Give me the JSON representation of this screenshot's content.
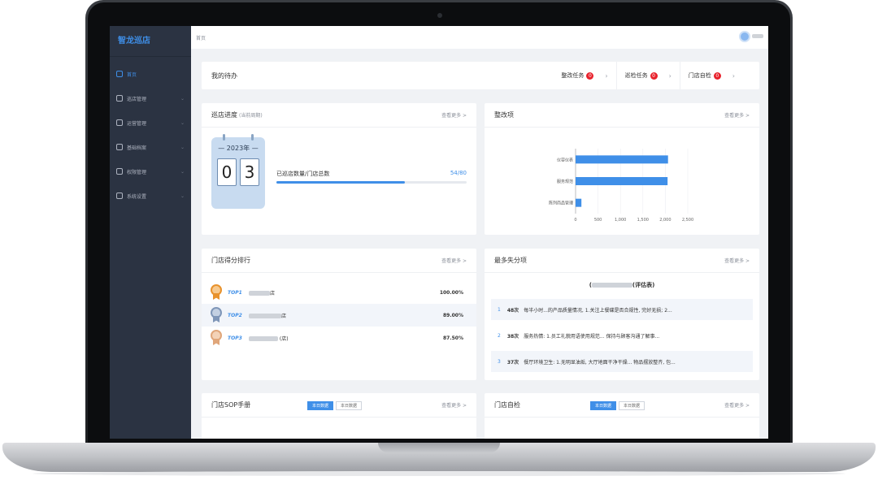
{
  "app": {
    "brand": "智龙巡店",
    "breadcrumb": "首页"
  },
  "sidebar": {
    "items": [
      {
        "label": "首页",
        "icon": "home-icon",
        "active": true
      },
      {
        "label": "巡店管理",
        "icon": "clipboard-icon",
        "active": false
      },
      {
        "label": "运营管理",
        "icon": "chart-icon",
        "active": false
      },
      {
        "label": "基础档案",
        "icon": "archive-icon",
        "active": false
      },
      {
        "label": "权限管理",
        "icon": "key-icon",
        "active": false
      },
      {
        "label": "系统设置",
        "icon": "gear-icon",
        "active": false
      }
    ]
  },
  "todo": {
    "title": "我的待办",
    "items": [
      {
        "label": "整改任务",
        "count": "0"
      },
      {
        "label": "巡检任务",
        "count": "0"
      },
      {
        "label": "门店自检",
        "count": "0"
      }
    ]
  },
  "progress": {
    "title": "巡店进度",
    "subtitle": "(当前周期)",
    "more": "查看更多 >",
    "year": "— 2023年 —",
    "digit1": "0",
    "digit2": "3",
    "label": "已巡店数量/门店总数",
    "value_text": "54/80",
    "fraction": 0.675
  },
  "rectification": {
    "title": "整改项",
    "more": "查看更多 >"
  },
  "chart_data": {
    "type": "bar",
    "orientation": "horizontal",
    "categories": [
      "仪容仪表",
      "服务规范",
      "陈列商品管理"
    ],
    "values": [
      2060,
      2050,
      130
    ],
    "xlim": [
      0,
      2500
    ],
    "xticks": [
      "0",
      "500",
      "1,000",
      "1,500",
      "2,000",
      "2,500"
    ],
    "color": "#3f8fe8",
    "grid": true
  },
  "ranking": {
    "title": "门店得分排行",
    "more": "查看更多 >",
    "rows": [
      {
        "rank": "TOP1",
        "name": "店",
        "value": "100.00%",
        "medal_color": "#e8922c"
      },
      {
        "rank": "TOP2",
        "name": "店",
        "value": "89.00%",
        "medal_color": "#7f96b8"
      },
      {
        "rank": "TOP3",
        "name": "(店)",
        "value": "87.50%",
        "medal_color": "#e0a67a"
      }
    ]
  },
  "deduction": {
    "title": "最多失分项",
    "more": "查看更多 >",
    "subtitle": "(评估表)",
    "rows": [
      {
        "index": "1",
        "count": "48次",
        "text": "每半小时...的产品质量情况, 1.关注上餐碟是否合规性, 完好无损; 2..."
      },
      {
        "index": "2",
        "count": "38次",
        "text": "服务热情: 1.员工礼貌用语使用规范... 保持与顾客沟通了解事..."
      },
      {
        "index": "3",
        "count": "37次",
        "text": "餐厅环境卫生: 1.无明显油垢, 大厅地面干净干燥... 物品摆放整齐, 包..."
      }
    ]
  },
  "sop": {
    "title": "门店SOP手册",
    "tab_on": "本日数据",
    "tab_off": "本日数据",
    "more": "查看更多 >"
  },
  "selfcheck": {
    "title": "门店自检",
    "tab_on": "本日数据",
    "tab_off": "本日数据",
    "more": "查看更多 >"
  }
}
